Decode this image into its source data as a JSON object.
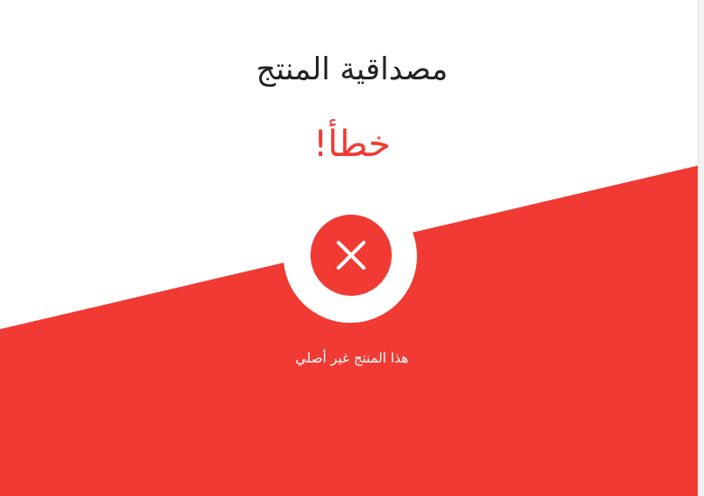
{
  "page": {
    "title": "مصداقية المنتج",
    "status": "خطأ!",
    "message": "هذا المنتج غير أصلي"
  },
  "icons": {
    "status_icon": "close-icon"
  },
  "colors": {
    "accent": "#f03a33",
    "background": "#ffffff",
    "title_text": "#222222",
    "message_text": "#ffffff"
  }
}
